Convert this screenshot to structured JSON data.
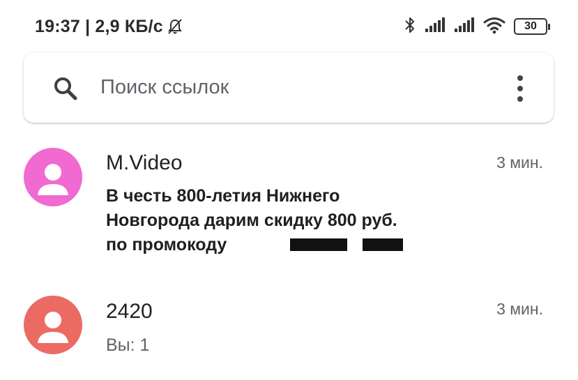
{
  "status_bar": {
    "time_and_speed": "19:37 | 2,9 КБ/с",
    "battery": "30",
    "icons": [
      "bell-off-icon",
      "bluetooth-icon",
      "signal-icon",
      "signal-icon",
      "wifi-icon",
      "battery-icon"
    ]
  },
  "search": {
    "placeholder": "Поиск ссылок",
    "icons": [
      "search-icon",
      "more-vert-icon"
    ]
  },
  "conversations": [
    {
      "name": "M.Video",
      "time": "3 мин.",
      "snippet_lines": [
        "В честь 800-летия Нижнего",
        "Новгорода дарим скидку 800 руб.",
        "по промокоду"
      ],
      "unread": true,
      "avatar_color": "#f06ad1"
    },
    {
      "name": "2420",
      "time": "3 мин.",
      "snippet": "Вы: 1",
      "unread": false,
      "avatar_color": "#eb6b63"
    }
  ]
}
